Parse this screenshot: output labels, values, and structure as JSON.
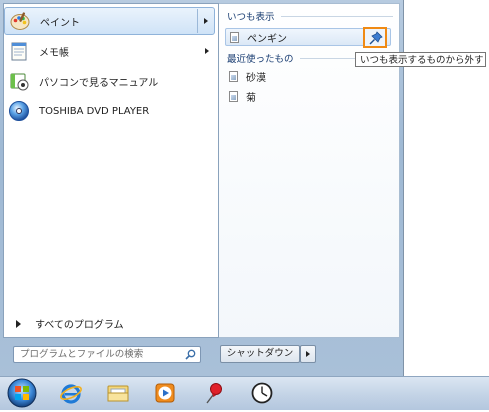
{
  "programs": [
    {
      "label": "ペイント",
      "has_submenu": true,
      "selected": true,
      "icon": "paint-icon"
    },
    {
      "label": "メモ帳",
      "has_submenu": true,
      "selected": false,
      "icon": "notepad-icon"
    },
    {
      "label": "パソコンで見るマニュアル",
      "has_submenu": false,
      "selected": false,
      "icon": "manual-icon"
    },
    {
      "label": "TOSHIBA DVD PLAYER",
      "has_submenu": false,
      "selected": false,
      "icon": "dvd-player-icon"
    }
  ],
  "all_programs_label": "すべてのプログラム",
  "search": {
    "placeholder": "プログラムとファイルの検索"
  },
  "shutdown_label": "シャットダウン",
  "jump_list": {
    "pinned_title": "いつも表示",
    "pinned_items": [
      "ペンギン"
    ],
    "recent_title": "最近使ったもの",
    "recent_items": [
      "砂漠",
      "菊"
    ]
  },
  "tooltip": "いつも表示するものから外す",
  "taskbar": [
    "start-orb-icon",
    "internet-explorer-icon",
    "explorer-folder-icon",
    "media-player-icon",
    "pushpin-icon",
    "clock-icon"
  ],
  "colors": {
    "callout": "#f08a14",
    "link": "#1a3e72"
  }
}
